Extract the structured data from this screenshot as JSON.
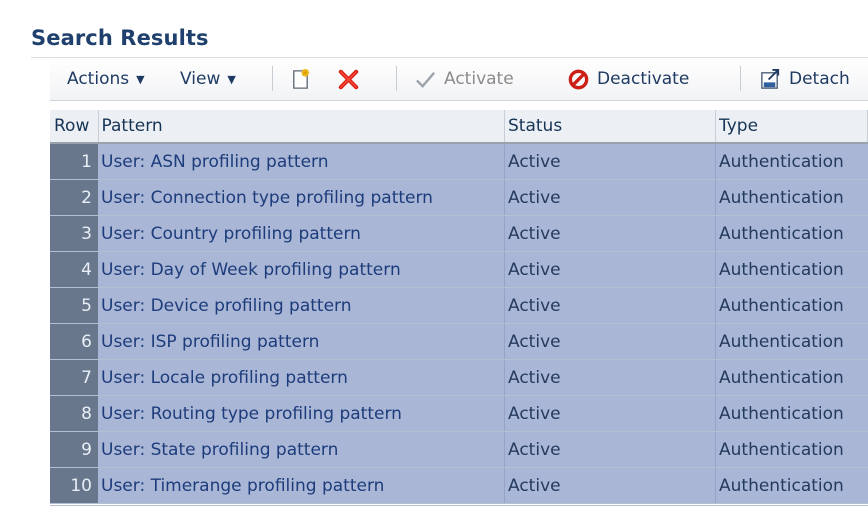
{
  "section": {
    "title": "Search Results"
  },
  "toolbar": {
    "actions": "Actions",
    "view": "View",
    "activate": "Activate",
    "deactivate": "Deactivate",
    "detach": "Detach"
  },
  "table": {
    "headers": [
      "Row",
      "Pattern",
      "Status",
      "Type"
    ],
    "rows": [
      {
        "row": "1",
        "pattern": "User: ASN profiling pattern",
        "status": "Active",
        "type": "Authentication"
      },
      {
        "row": "2",
        "pattern": "User: Connection type profiling pattern",
        "status": "Active",
        "type": "Authentication"
      },
      {
        "row": "3",
        "pattern": "User: Country profiling pattern",
        "status": "Active",
        "type": "Authentication"
      },
      {
        "row": "4",
        "pattern": "User: Day of Week profiling pattern",
        "status": "Active",
        "type": "Authentication"
      },
      {
        "row": "5",
        "pattern": "User: Device profiling pattern",
        "status": "Active",
        "type": "Authentication"
      },
      {
        "row": "6",
        "pattern": "User: ISP profiling pattern",
        "status": "Active",
        "type": "Authentication"
      },
      {
        "row": "7",
        "pattern": "User: Locale profiling pattern",
        "status": "Active",
        "type": "Authentication"
      },
      {
        "row": "8",
        "pattern": "User: Routing type profiling pattern",
        "status": "Active",
        "type": "Authentication"
      },
      {
        "row": "9",
        "pattern": "User: State profiling pattern",
        "status": "Active",
        "type": "Authentication"
      },
      {
        "row": "10",
        "pattern": "User: Timerange profiling pattern",
        "status": "Active",
        "type": "Authentication"
      }
    ]
  }
}
